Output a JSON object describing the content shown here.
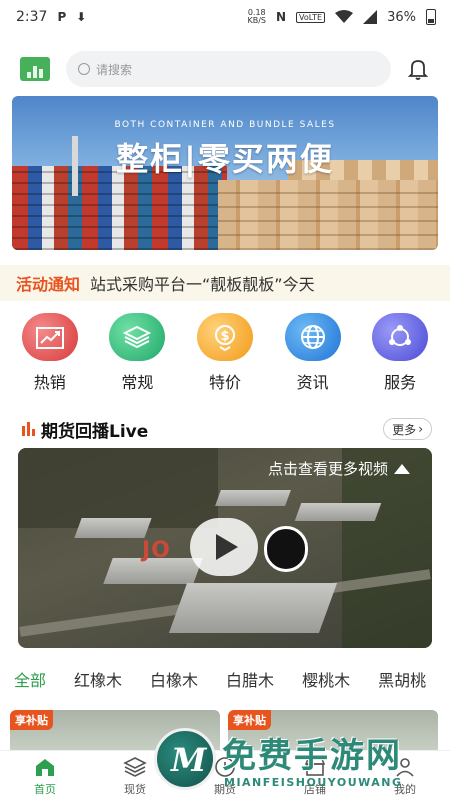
{
  "status_bar": {
    "time": "2:37",
    "net_speed_value": "0.18",
    "net_speed_unit": "KB/S",
    "volte": "VoLTE",
    "battery": "36%"
  },
  "header": {
    "search_placeholder": "请搜索"
  },
  "banner": {
    "subtitle": "BOTH CONTAINER AND BUNDLE SALES",
    "title": "整柜|零买两便"
  },
  "notice": {
    "tag": "活动通知",
    "text": "站式采购平台一“靓板靓板”今天"
  },
  "categories": [
    {
      "label": "热销",
      "icon": "chart-up-icon",
      "color_from": "#f06c6c",
      "color_to": "#d83a3a"
    },
    {
      "label": "常规",
      "icon": "layers-icon",
      "color_from": "#4fd08d",
      "color_to": "#21a86a"
    },
    {
      "label": "特价",
      "icon": "dollar-down-icon",
      "color_from": "#ffc24a",
      "color_to": "#f29a18"
    },
    {
      "label": "资讯",
      "icon": "globe-icon",
      "color_from": "#4aa6f0",
      "color_to": "#2174d6"
    },
    {
      "label": "服务",
      "icon": "share-icon",
      "color_from": "#7c7cf4",
      "color_to": "#4a4ad6"
    }
  ],
  "live_section": {
    "title": "期货回播Live",
    "more": "更多"
  },
  "video": {
    "caption": "点击查看更多视频",
    "brand": "JO"
  },
  "tabs": [
    "全部",
    "红橡木",
    "白橡木",
    "白腊木",
    "樱桃木",
    "黑胡桃"
  ],
  "active_tab": 0,
  "cards": [
    {
      "badge": "享补贴"
    },
    {
      "badge": "享补贴"
    }
  ],
  "bottom_nav": [
    {
      "label": "首页",
      "icon": "home-icon",
      "active": true
    },
    {
      "label": "现货",
      "icon": "layers-icon",
      "active": false
    },
    {
      "label": "期货",
      "icon": "clock-icon",
      "active": false
    },
    {
      "label": "店铺",
      "icon": "store-icon",
      "active": false
    },
    {
      "label": "我的",
      "icon": "user-icon",
      "active": false
    }
  ],
  "watermark": {
    "text": "免费手游网",
    "sub": "MIANFEISHOUYOUWANG"
  },
  "colors": {
    "accent_green": "#2e9e4f",
    "accent_orange": "#e8541e",
    "notice_bg": "#fbf6ea"
  }
}
